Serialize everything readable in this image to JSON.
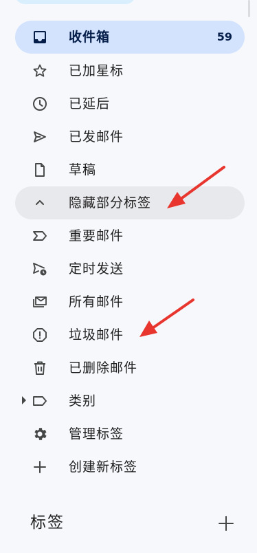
{
  "nav": {
    "items": [
      {
        "label": "收件箱",
        "count": "59",
        "icon": "inbox-icon"
      },
      {
        "label": "已加星标",
        "icon": "star-icon"
      },
      {
        "label": "已延后",
        "icon": "clock-icon"
      },
      {
        "label": "已发邮件",
        "icon": "send-icon"
      },
      {
        "label": "草稿",
        "icon": "draft-icon"
      },
      {
        "label": "隐藏部分标签",
        "icon": "chevron-up-icon"
      },
      {
        "label": "重要邮件",
        "icon": "important-icon"
      },
      {
        "label": "定时发送",
        "icon": "scheduled-send-icon"
      },
      {
        "label": "所有邮件",
        "icon": "all-mail-icon"
      },
      {
        "label": "垃圾邮件",
        "icon": "spam-icon"
      },
      {
        "label": "已删除邮件",
        "icon": "trash-icon"
      },
      {
        "label": "类别",
        "icon": "label-icon"
      },
      {
        "label": "管理标签",
        "icon": "gear-icon"
      },
      {
        "label": "创建新标签",
        "icon": "plus-icon"
      }
    ]
  },
  "labels_section": {
    "title": "标签",
    "add_icon": "plus-icon"
  },
  "colors": {
    "active_bg": "#d3e3fd",
    "annotation_arrow": "#e8362f"
  }
}
